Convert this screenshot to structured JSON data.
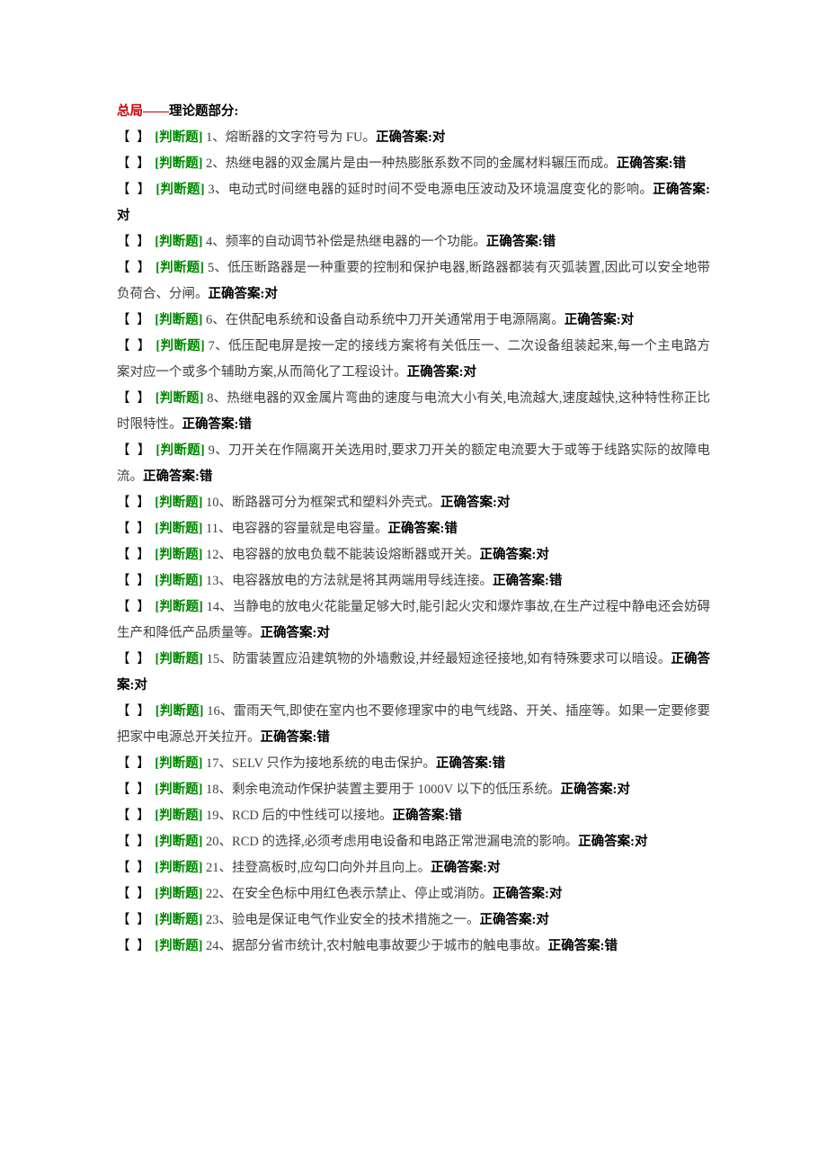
{
  "section_title": {
    "red": "总局——",
    "black": "理论题部分:"
  },
  "bracket": "【  】",
  "tag_label": "[判断题]",
  "ans_label": "正确答案:",
  "items": [
    {
      "n": 1,
      "text": "熔断器的文字符号为 FU。",
      "ans": "对"
    },
    {
      "n": 2,
      "text": "热继电器的双金属片是由一种热膨胀系数不同的金属材料辗压而成。",
      "ans": "错"
    },
    {
      "n": 3,
      "text": "电动式时间继电器的延时时间不受电源电压波动及环境温度变化的影响。",
      "ans": "对"
    },
    {
      "n": 4,
      "text": "频率的自动调节补偿是热继电器的一个功能。",
      "ans": "错"
    },
    {
      "n": 5,
      "text": "低压断路器是一种重要的控制和保护电器,断路器都装有灭弧装置,因此可以安全地带负荷合、分闸。",
      "ans": "对"
    },
    {
      "n": 6,
      "text": "在供配电系统和设备自动系统中刀开关通常用于电源隔离。",
      "ans": "对"
    },
    {
      "n": 7,
      "text": "低压配电屏是按一定的接线方案将有关低压一、二次设备组装起来,每一个主电路方案对应一个或多个辅助方案,从而简化了工程设计。",
      "ans": "对"
    },
    {
      "n": 8,
      "text": "热继电器的双金属片弯曲的速度与电流大小有关,电流越大,速度越快,这种特性称正比时限特性。",
      "ans": "错"
    },
    {
      "n": 9,
      "text": "刀开关在作隔离开关选用时,要求刀开关的额定电流要大于或等于线路实际的故障电流。",
      "ans": "错"
    },
    {
      "n": 10,
      "text": "断路器可分为框架式和塑料外壳式。",
      "ans": "对"
    },
    {
      "n": 11,
      "text": "电容器的容量就是电容量。",
      "ans": "错"
    },
    {
      "n": 12,
      "text": "电容器的放电负载不能装设熔断器或开关。",
      "ans": "对"
    },
    {
      "n": 13,
      "text": "电容器放电的方法就是将其两端用导线连接。",
      "ans": "错"
    },
    {
      "n": 14,
      "text": "当静电的放电火花能量足够大时,能引起火灾和爆炸事故,在生产过程中静电还会妨碍生产和降低产品质量等。",
      "ans": "对"
    },
    {
      "n": 15,
      "text": "防雷装置应沿建筑物的外墙敷设,并经最短途径接地,如有特殊要求可以暗设。",
      "ans": "对"
    },
    {
      "n": 16,
      "text": "雷雨天气,即使在室内也不要修理家中的电气线路、开关、插座等。如果一定要修要把家中电源总开关拉开。",
      "ans": "错"
    },
    {
      "n": 17,
      "text": "SELV 只作为接地系统的电击保护。",
      "ans": "错"
    },
    {
      "n": 18,
      "text": "剩余电流动作保护装置主要用于 1000V 以下的低压系统。",
      "ans": "对"
    },
    {
      "n": 19,
      "text": "RCD 后的中性线可以接地。",
      "ans": "错"
    },
    {
      "n": 20,
      "text": "RCD 的选择,必须考虑用电设备和电路正常泄漏电流的影响。",
      "ans": "对"
    },
    {
      "n": 21,
      "text": "挂登高板时,应勾口向外并且向上。",
      "ans": "对"
    },
    {
      "n": 22,
      "text": "在安全色标中用红色表示禁止、停止或消防。",
      "ans": "对"
    },
    {
      "n": 23,
      "text": "验电是保证电气作业安全的技术措施之一。",
      "ans": "对"
    },
    {
      "n": 24,
      "text": "据部分省市统计,农村触电事故要少于城市的触电事故。",
      "ans": "错"
    }
  ]
}
